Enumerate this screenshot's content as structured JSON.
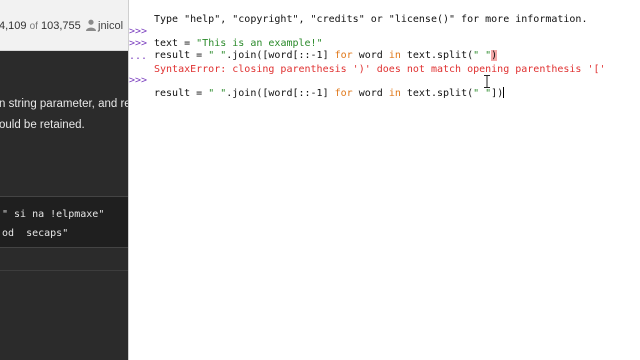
{
  "website": {
    "stats": "4,109",
    "stats_of": "of",
    "stats_total": "103,755",
    "username": "jnicol",
    "description_lines": [
      "n string parameter, and re",
      "ould be retained."
    ],
    "code_lines": [
      "\" si na !elpmaxe\"",
      "od  secaps\""
    ]
  },
  "shell": {
    "banner": "Type \"help\", \"copyright\", \"credits\" or \"license()\" for more information.",
    "prompt": ">>>",
    "continuation": "...",
    "line1_code_a": "text = ",
    "line1_string": "\"This is an example!\"",
    "line2_prefix": "result = ",
    "line2_string_a": "\" \"",
    "line2_mid": ".join([word[::-1] ",
    "kw_for": "for",
    "line2_word": " word ",
    "kw_in": "in",
    "line2_split": " text.split(",
    "line2_string_b": "\" \"",
    "line2_close_bad": ")",
    "error_message": "SyntaxError: closing parenthesis ')' does not match opening parenthesis '['",
    "line3_close_good": "])",
    "accent_prompt": "#7b3fbf",
    "accent_string": "#2a8a2a",
    "accent_keyword": "#e0781a",
    "accent_error": "#e03131"
  }
}
